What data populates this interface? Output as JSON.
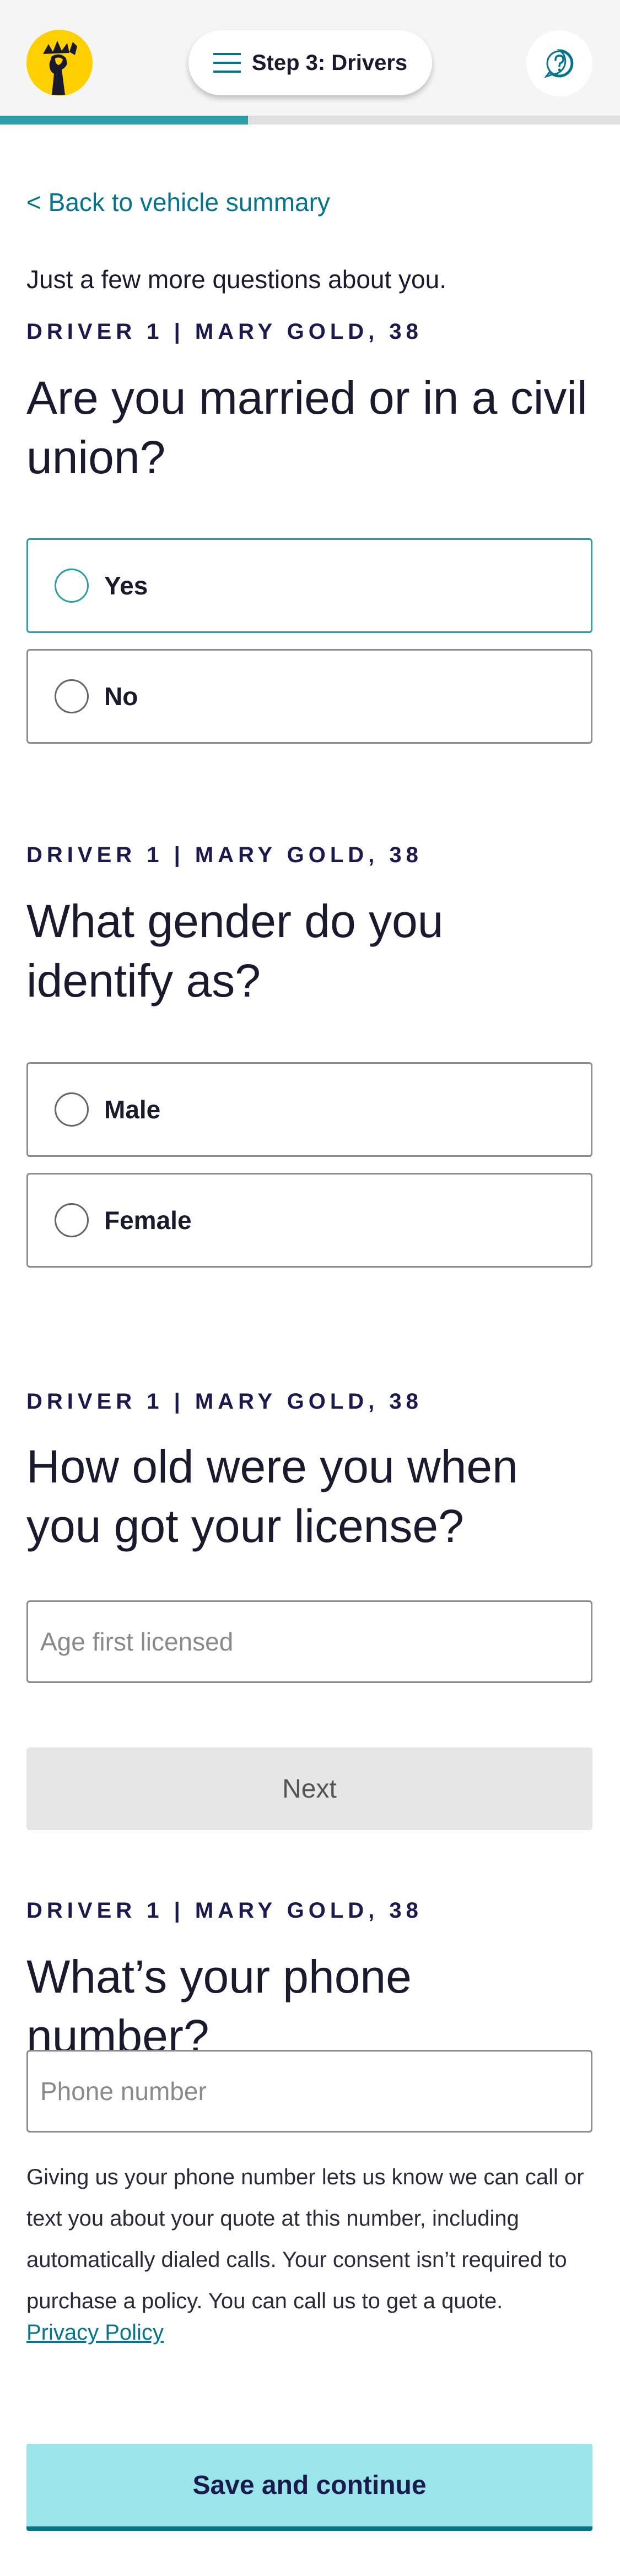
{
  "header": {
    "logo": "liberty-statue-logo",
    "step_label": "Step 3: Drivers",
    "menu_icon": "hamburger-icon",
    "help_icon": "help-icon",
    "progress": 0.4,
    "colors": {
      "accent": "#2a9fa8",
      "logo_bg": "#ffd000"
    }
  },
  "back_link": "< Back to vehicle summary",
  "intro": "Just a few more questions about you.",
  "questions": [
    {
      "driver_label": "DRIVER 1 | MARY GOLD, 38",
      "text": "Are you married or in a civil union?",
      "options": [
        "Yes",
        "No"
      ]
    },
    {
      "driver_label": "DRIVER 1 | MARY GOLD, 38",
      "text": "What gender do you identify as?",
      "options": [
        "Male",
        "Female"
      ]
    },
    {
      "driver_label": "DRIVER 1 | MARY GOLD, 38",
      "text": "How old were you when you got your license?",
      "input_placeholder": "Age first licensed",
      "input_value": ""
    },
    {
      "driver_label": "DRIVER 1 | MARY GOLD, 38",
      "text": "What’s your phone number?",
      "input_placeholder": "Phone number",
      "input_value": ""
    }
  ],
  "next_button": "Next",
  "consent_text": "Giving us your phone number lets us know we can call or text you about your quote at this number, including automatically dialed calls. Your consent isn’t required to purchase a policy. You can call us to get a quote.",
  "privacy_link": "Privacy Policy",
  "save_button": "Save and continue"
}
